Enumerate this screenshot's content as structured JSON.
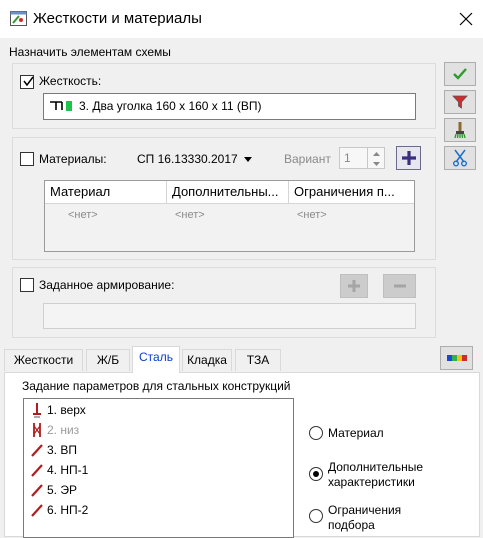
{
  "window": {
    "title": "Жесткости и материалы"
  },
  "assign_label": "Назначить элементам схемы",
  "stiffness": {
    "label": "Жесткость:",
    "checked": true,
    "value": "3. Два уголка 160 x 160 x 11 (ВП)"
  },
  "materials": {
    "label": "Материалы:",
    "checked": false,
    "norm": "СП 16.13330.2017",
    "variant_label": "Вариант",
    "variant_value": "1",
    "columns": [
      "Материал",
      "Дополнительны...",
      "Ограничения п..."
    ],
    "row": [
      "<нет>",
      "<нет>",
      "<нет>"
    ]
  },
  "reinforcement": {
    "label": "Заданное армирование:",
    "checked": false
  },
  "tabs": [
    "Жесткости",
    "Ж/Б",
    "Сталь",
    "Кладка",
    "ТЗА"
  ],
  "active_tab": "Сталь",
  "steel": {
    "heading": "Задание параметров для стальных конструкций",
    "items": [
      {
        "label": "1. верх",
        "icon": "red-bolt-icon",
        "disabled": false
      },
      {
        "label": "2. низ",
        "icon": "crossed-bolt-icon",
        "disabled": true
      },
      {
        "label": "3. ВП",
        "icon": "red-rod-icon",
        "disabled": false
      },
      {
        "label": "4. НП-1",
        "icon": "red-rod-icon",
        "disabled": false
      },
      {
        "label": "5. ЭР",
        "icon": "red-rod-icon",
        "disabled": false
      },
      {
        "label": "6. НП-2",
        "icon": "red-rod-icon",
        "disabled": false
      }
    ],
    "radios": [
      {
        "label": "Материал",
        "checked": false
      },
      {
        "label": "Дополнительные характеристики",
        "checked": true
      },
      {
        "label": "Ограничения подбора",
        "checked": false
      }
    ]
  },
  "side_buttons": [
    "apply-check-icon",
    "filter-icon",
    "brush-icon",
    "scissors-icon"
  ],
  "colors": {
    "accent": "#0a3fd0",
    "check_green": "#2e9b2e",
    "filter_red": "#d12c2c"
  }
}
